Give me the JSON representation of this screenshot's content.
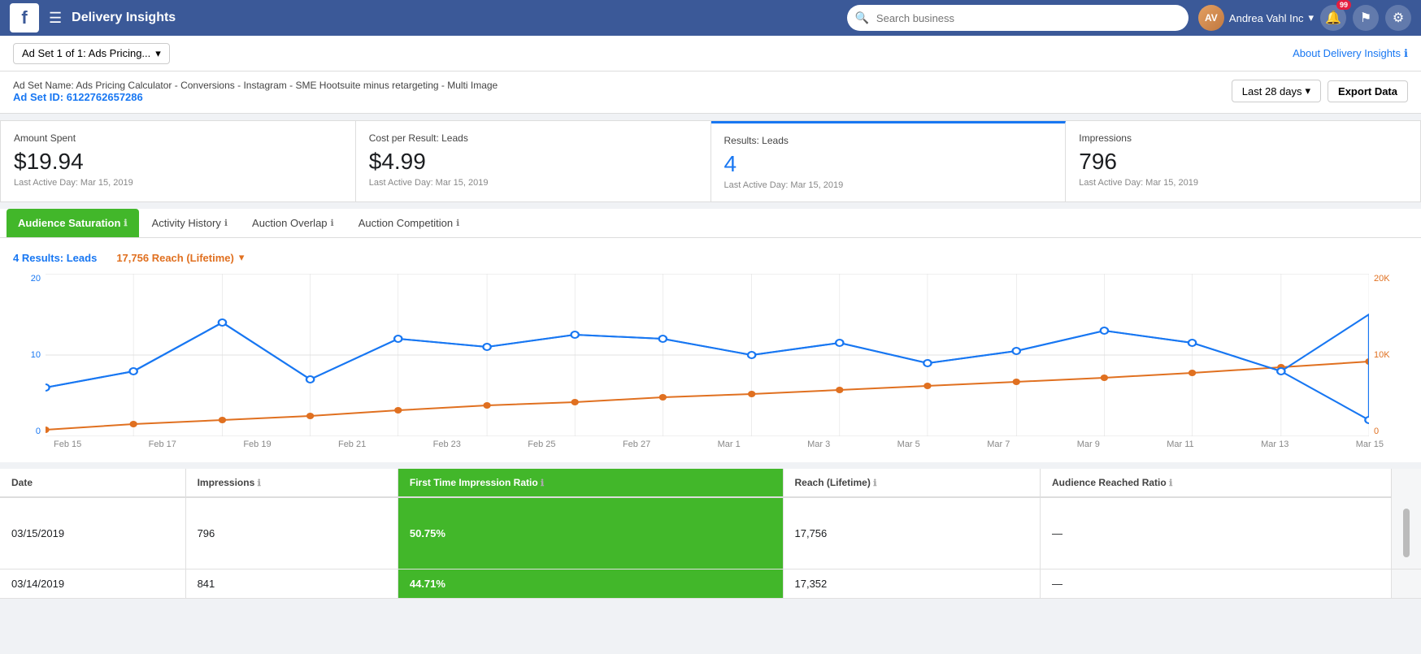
{
  "nav": {
    "title": "Delivery Insights",
    "search_placeholder": "Search business",
    "user_name": "Andrea Vahl Inc",
    "notification_count": "99",
    "fb_letter": "f"
  },
  "sub_nav": {
    "ad_set_selector": "Ad Set 1 of 1: Ads Pricing...",
    "about_link": "About Delivery Insights"
  },
  "ad_set_info": {
    "label": "Ad Set Name: Ads Pricing Calculator - Conversions - Instagram - SME Hootsuite minus retargeting - Multi Image",
    "id_label": "Ad Set ID:",
    "id_value": "6122762657286",
    "date_btn": "Last 28 days",
    "export_btn": "Export Data"
  },
  "metrics": [
    {
      "label": "Amount Spent",
      "value": "$19.94",
      "sub": "Last Active Day: Mar 15, 2019",
      "active": false,
      "blue": false
    },
    {
      "label": "Cost per Result: Leads",
      "value": "$4.99",
      "sub": "Last Active Day: Mar 15, 2019",
      "active": false,
      "blue": false
    },
    {
      "label": "Results: Leads",
      "value": "4",
      "sub": "Last Active Day: Mar 15, 2019",
      "active": true,
      "blue": true
    },
    {
      "label": "Impressions",
      "value": "796",
      "sub": "Last Active Day: Mar 15, 2019",
      "active": false,
      "blue": false
    }
  ],
  "tabs": [
    {
      "label": "Audience Saturation",
      "active": true,
      "has_info": true
    },
    {
      "label": "Activity History",
      "active": false,
      "has_info": true
    },
    {
      "label": "Auction Overlap",
      "active": false,
      "has_info": true
    },
    {
      "label": "Auction Competition",
      "active": false,
      "has_info": true
    }
  ],
  "chart": {
    "results_label": "4 Results: Leads",
    "reach_label": "17,756 Reach (Lifetime)",
    "y_left": [
      "20",
      "10",
      "0"
    ],
    "y_right": [
      "20K",
      "10K",
      "0"
    ],
    "x_labels": [
      "Feb 15",
      "Feb 17",
      "Feb 19",
      "Feb 21",
      "Feb 23",
      "Feb 25",
      "Feb 27",
      "Mar 1",
      "Mar 3",
      "Mar 5",
      "Mar 7",
      "Mar 9",
      "Mar 11",
      "Mar 13",
      "Mar 15"
    ]
  },
  "table": {
    "columns": [
      {
        "label": "Date",
        "has_info": false
      },
      {
        "label": "Impressions",
        "has_info": true
      },
      {
        "label": "First Time Impression Ratio",
        "has_info": true
      },
      {
        "label": "Reach (Lifetime)",
        "has_info": true
      },
      {
        "label": "Audience Reached Ratio",
        "has_info": true
      }
    ],
    "rows": [
      {
        "date": "03/15/2019",
        "impressions": "796",
        "first_ratio": "50.75%",
        "reach": "17,756",
        "audience_ratio": "—"
      },
      {
        "date": "03/14/2019",
        "impressions": "841",
        "first_ratio": "44.71%",
        "reach": "17,352",
        "audience_ratio": "—"
      }
    ]
  }
}
